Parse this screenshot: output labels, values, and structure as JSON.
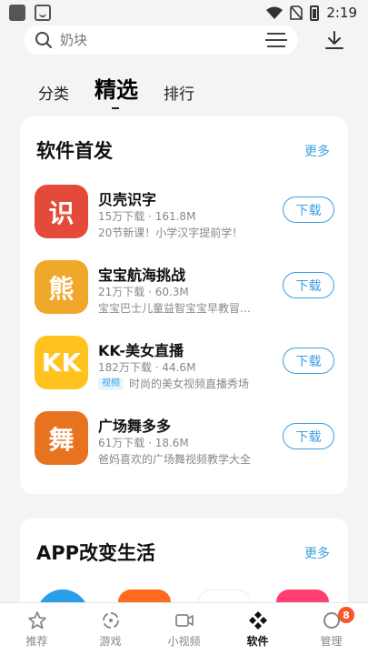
{
  "status": {
    "time": "2:19"
  },
  "search": {
    "placeholder": "奶块"
  },
  "tabs": [
    {
      "label": "分类"
    },
    {
      "label": "精选"
    },
    {
      "label": "排行"
    }
  ],
  "section1": {
    "title": "软件首发",
    "more": "更多",
    "apps": [
      {
        "name": "贝壳识字",
        "meta": "15万下载 · 161.8M",
        "desc": "20节新课！小学汉字提前学！",
        "button": "下载",
        "icon": "识",
        "icon_color": "#e34a3a",
        "tag": ""
      },
      {
        "name": "宝宝航海挑战",
        "meta": "21万下载 · 60.3M",
        "desc": "宝宝巴士儿童益智宝宝早教冒…",
        "button": "下载",
        "icon": "熊",
        "icon_color": "#f0a82a",
        "tag": ""
      },
      {
        "name": "KK-美女直播",
        "meta": "182万下载 · 44.6M",
        "desc": "时尚的美女视频直播秀场",
        "button": "下载",
        "icon": "KK",
        "icon_color": "#ffc21f",
        "tag": "视频"
      },
      {
        "name": "广场舞多多",
        "meta": "61万下载 · 18.6M",
        "desc": "爸妈喜欢的广场舞视频教学大全",
        "button": "下载",
        "icon": "舞",
        "icon_color": "#e8731f",
        "tag": ""
      }
    ]
  },
  "section2": {
    "title": "APP改变生活",
    "more": "更多"
  },
  "nav": [
    {
      "label": "推荐",
      "icon": "star-icon"
    },
    {
      "label": "游戏",
      "icon": "game-icon"
    },
    {
      "label": "小视频",
      "icon": "video-icon"
    },
    {
      "label": "软件",
      "icon": "software-icon"
    },
    {
      "label": "管理",
      "icon": "manage-icon",
      "badge": "8"
    }
  ],
  "colors": {
    "accent": "#3aa1e0",
    "badge": "#f5562b"
  }
}
